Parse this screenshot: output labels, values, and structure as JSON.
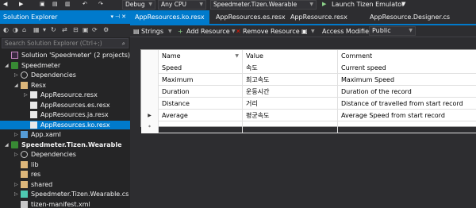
{
  "toolbar": {
    "config": "Debug",
    "platform": "Any CPU",
    "startup_project": "Speedmeter.Tizen.Wearable",
    "launch_label": "Launch Tizen Emulator"
  },
  "solution_explorer": {
    "title": "Solution Explorer",
    "search_placeholder": "Search Solution Explorer (Ctrl+;)",
    "tree": [
      {
        "label": "Solution 'Speedmeter' (2 projects)",
        "icon": "solution-icon",
        "level": 0,
        "expander": ""
      },
      {
        "label": "Speedmeter",
        "icon": "project-icon",
        "level": 0,
        "expander": "◢"
      },
      {
        "label": "Dependencies",
        "icon": "dependencies-icon",
        "level": 1,
        "expander": "▷"
      },
      {
        "label": "Resx",
        "icon": "folder-icon",
        "level": 1,
        "expander": "◢"
      },
      {
        "label": "AppResource.resx",
        "icon": "resx-file-icon",
        "level": 2,
        "expander": "▷"
      },
      {
        "label": "AppResources.es.resx",
        "icon": "resx-file-icon",
        "level": 2,
        "expander": ""
      },
      {
        "label": "AppResources.ja.resx",
        "icon": "resx-file-icon",
        "level": 2,
        "expander": ""
      },
      {
        "label": "AppResources.ko.resx",
        "icon": "resx-file-icon",
        "level": 2,
        "expander": "",
        "selected": true
      },
      {
        "label": "App.xaml",
        "icon": "xaml-file-icon",
        "level": 1,
        "expander": "▷"
      },
      {
        "label": "Speedmeter.Tizen.Wearable",
        "icon": "project-icon",
        "level": 0,
        "expander": "◢",
        "bold": true
      },
      {
        "label": "Dependencies",
        "icon": "dependencies-icon",
        "level": 1,
        "expander": "▷"
      },
      {
        "label": "lib",
        "icon": "folder-icon",
        "level": 1,
        "expander": ""
      },
      {
        "label": "res",
        "icon": "folder-icon",
        "level": 1,
        "expander": ""
      },
      {
        "label": "shared",
        "icon": "folder-icon",
        "level": 1,
        "expander": "▷"
      },
      {
        "label": "Speedmeter.Tizen.Wearable.cs",
        "icon": "cs-file-icon",
        "level": 1,
        "expander": "▷"
      },
      {
        "label": "tizen-manifest.xml",
        "icon": "xml-file-icon",
        "level": 1,
        "expander": ""
      }
    ]
  },
  "tabs": [
    {
      "label": "AppResources.ko.resx",
      "active": true
    },
    {
      "label": "AppResources.es.resx",
      "active": false
    },
    {
      "label": "AppResource.resx",
      "active": false
    },
    {
      "label": "AppResource.Designer.cs",
      "active": false
    }
  ],
  "resource_toolbar": {
    "strings_label": "Strings",
    "add_resource_label": "Add Resource",
    "remove_resource_label": "Remove Resource",
    "access_modifier_label": "Access Modifier:",
    "access_modifier_value": "Public"
  },
  "grid": {
    "columns": [
      "Name",
      "Value",
      "Comment"
    ],
    "rows": [
      {
        "name": "Speed",
        "value": "속도",
        "comment": "Current speed",
        "marker": ""
      },
      {
        "name": "Maximum",
        "value": "최고속도",
        "comment": "Maximum Speed",
        "marker": ""
      },
      {
        "name": "Duration",
        "value": "운동시간",
        "comment": "Duration of the record",
        "marker": ""
      },
      {
        "name": "Distance",
        "value": "거리",
        "comment": "Distance of travelled from start record",
        "marker": ""
      },
      {
        "name": "Average",
        "value": "평균속도",
        "comment": "Average Speed from start record",
        "marker": "▶"
      },
      {
        "name": "",
        "value": "",
        "comment": "",
        "marker": "*"
      }
    ]
  },
  "colors": {
    "accent": "#007acc",
    "background": "#2d2d30",
    "panel": "#252526"
  }
}
